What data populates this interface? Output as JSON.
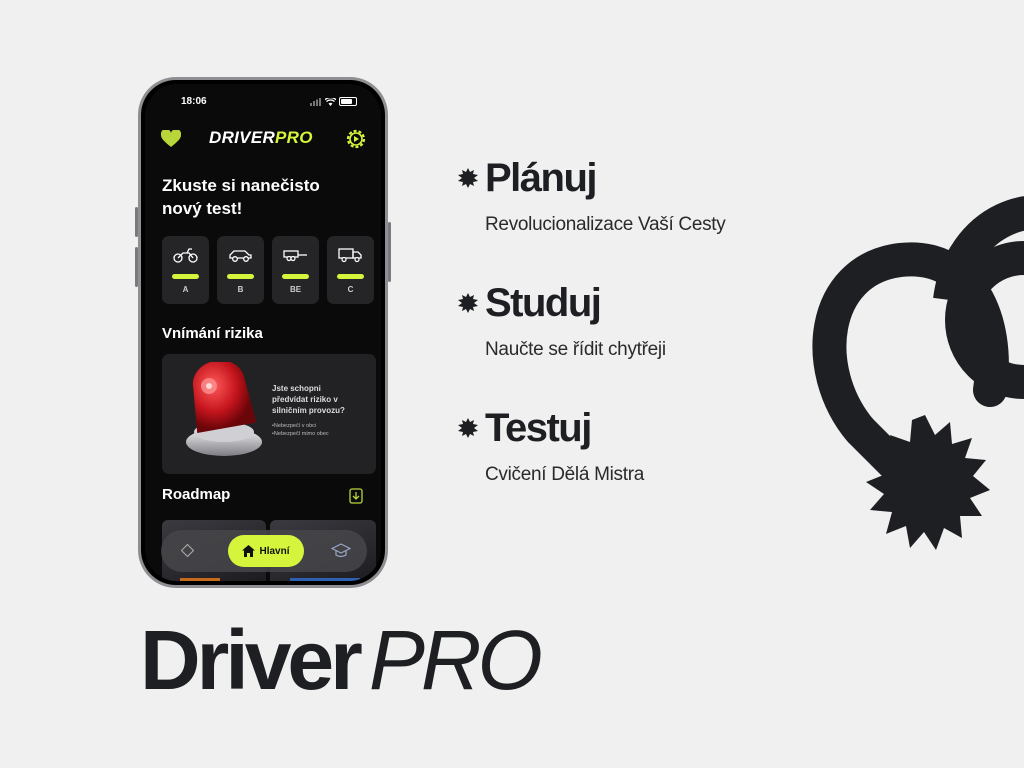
{
  "phone": {
    "status": {
      "time": "18:06"
    },
    "header": {
      "logo_main": "DRIVER",
      "logo_accent": "PRO"
    },
    "heading_line1": "Zkuste si nanečisto",
    "heading_line2": "nový test!",
    "categories": [
      {
        "label": "A",
        "icon": "motorcycle-icon"
      },
      {
        "label": "B",
        "icon": "car-icon"
      },
      {
        "label": "BE",
        "icon": "car-trailer-icon"
      },
      {
        "label": "C",
        "icon": "truck-icon"
      }
    ],
    "risk": {
      "title": "Vnímání rizika",
      "question_lines": [
        "Jste schopni",
        "předvídat riziko v",
        "silničním provozu?"
      ],
      "bullets": [
        "•Nebezpečí v obci",
        "•Nebezpečí mimo obec"
      ]
    },
    "roadmap": {
      "title": "Roadmap"
    },
    "tab_bar": {
      "home_label": "Hlavní"
    }
  },
  "features": [
    {
      "title": "Plánuj",
      "subtitle": "Revolucionalizace Vaší Cesty"
    },
    {
      "title": "Studuj",
      "subtitle": "Naučte se řídit chytřeji"
    },
    {
      "title": "Testuj",
      "subtitle": "Cvičení Dělá Mistra"
    }
  ],
  "brand": {
    "part1": "Driver",
    "part2": "PRO"
  },
  "colors": {
    "accent": "#d4f53c",
    "background": "#f0f0f0",
    "dark": "#1e1f22"
  }
}
